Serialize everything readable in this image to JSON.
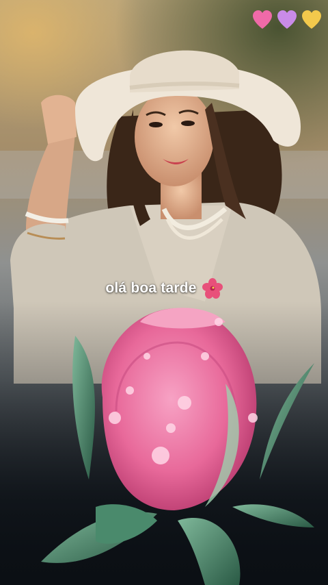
{
  "caption": {
    "text": "olá boa tarde",
    "emoji_icon": "hibiscus-icon"
  },
  "hearts": [
    {
      "icon": "heart-icon",
      "color": "#f06aa8"
    },
    {
      "icon": "heart-icon",
      "color": "#c98be8"
    },
    {
      "icon": "heart-icon",
      "color": "#f2c94c"
    }
  ],
  "palette": {
    "sky": "#c9c6bd",
    "background_blur": "#8a7a5a",
    "hat": "#efe6d8",
    "sweater": "#cfc7b8",
    "rose": "#e86a9a",
    "leaf": "#3f7a5e",
    "shadow": "#0b0f14"
  }
}
